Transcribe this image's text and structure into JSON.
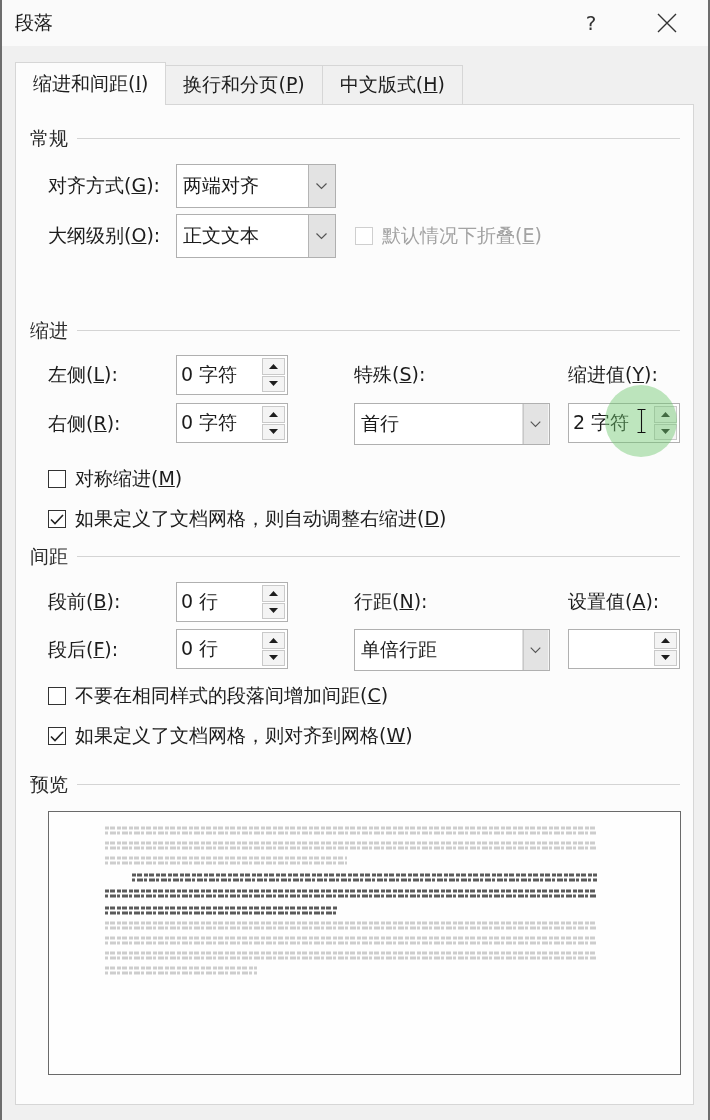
{
  "window": {
    "title": "段落",
    "help": "?"
  },
  "tabs": [
    {
      "label": {
        "before": "缩进和间距(",
        "access_key": "I",
        "after": ")"
      },
      "selected": true
    },
    {
      "label": {
        "before": "换行和分页(",
        "access_key": "P",
        "after": ")"
      },
      "selected": false
    },
    {
      "label": {
        "before": "中文版式(",
        "access_key": "H",
        "after": ")"
      },
      "selected": false
    }
  ],
  "general": {
    "heading": "常规",
    "alignment": {
      "label": {
        "before": "对齐方式(",
        "access_key": "G",
        "after": "):"
      },
      "value": "两端对齐"
    },
    "outline_level": {
      "label": {
        "before": "大纲级别(",
        "access_key": "O",
        "after": "):"
      },
      "value": "正文文本"
    },
    "collapse_by_default": {
      "label": {
        "before": "默认情况下折叠(",
        "access_key": "E",
        "after": ")"
      },
      "checked": false,
      "disabled": true
    }
  },
  "indentation": {
    "heading": "缩进",
    "left": {
      "label": {
        "before": "左侧(",
        "access_key": "L",
        "after": "):"
      },
      "value": "0 字符"
    },
    "right": {
      "label": {
        "before": "右侧(",
        "access_key": "R",
        "after": "):"
      },
      "value": "0 字符"
    },
    "special": {
      "label": {
        "before": "特殊(",
        "access_key": "S",
        "after": "):"
      },
      "value": "首行"
    },
    "by": {
      "label": {
        "before": "缩进值(",
        "access_key": "Y",
        "after": "):"
      },
      "value": "2 字符"
    },
    "checkboxes": [
      {
        "label": {
          "before": "对称缩进(",
          "access_key": "M",
          "after": ")"
        },
        "checked": false
      },
      {
        "label": {
          "before": "如果定义了文档网格，则自动调整右缩进(",
          "access_key": "D",
          "after": ")"
        },
        "checked": true
      }
    ]
  },
  "spacing": {
    "heading": "间距",
    "before": {
      "label": {
        "before": "段前(",
        "access_key": "B",
        "after": "):"
      },
      "value": "0 行"
    },
    "after": {
      "label": {
        "before": "段后(",
        "access_key": "F",
        "after": "):"
      },
      "value": "0 行"
    },
    "line_spacing": {
      "label": {
        "before": "行距(",
        "access_key": "N",
        "after": "):"
      },
      "value": "单倍行距"
    },
    "at": {
      "label": {
        "before": "设置值(",
        "access_key": "A",
        "after": "):"
      }
    },
    "checkboxes": [
      {
        "label": {
          "before": "不要在相同样式的段落间增加间距(",
          "access_key": "C",
          "after": ")"
        },
        "checked": false
      },
      {
        "label": {
          "before": "如果定义了文档网格，则对齐到网格(",
          "access_key": "W",
          "after": ")"
        },
        "checked": true
      }
    ]
  },
  "preview": {
    "heading": "预览"
  }
}
